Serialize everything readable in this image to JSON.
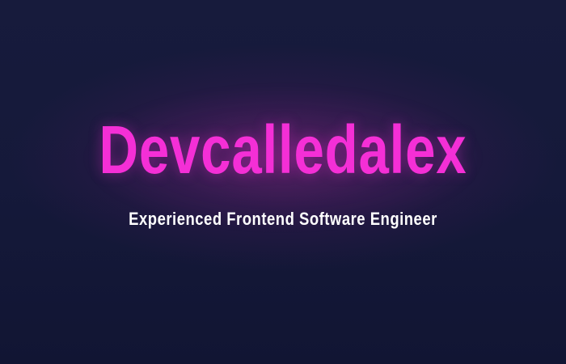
{
  "hero": {
    "title": "Devcalledalex",
    "subtitle": "Experienced Frontend Software Engineer"
  },
  "colors": {
    "background": "#15183a",
    "title": "#f42fd6",
    "subtitle": "#ffffff",
    "glow": "#702270"
  }
}
